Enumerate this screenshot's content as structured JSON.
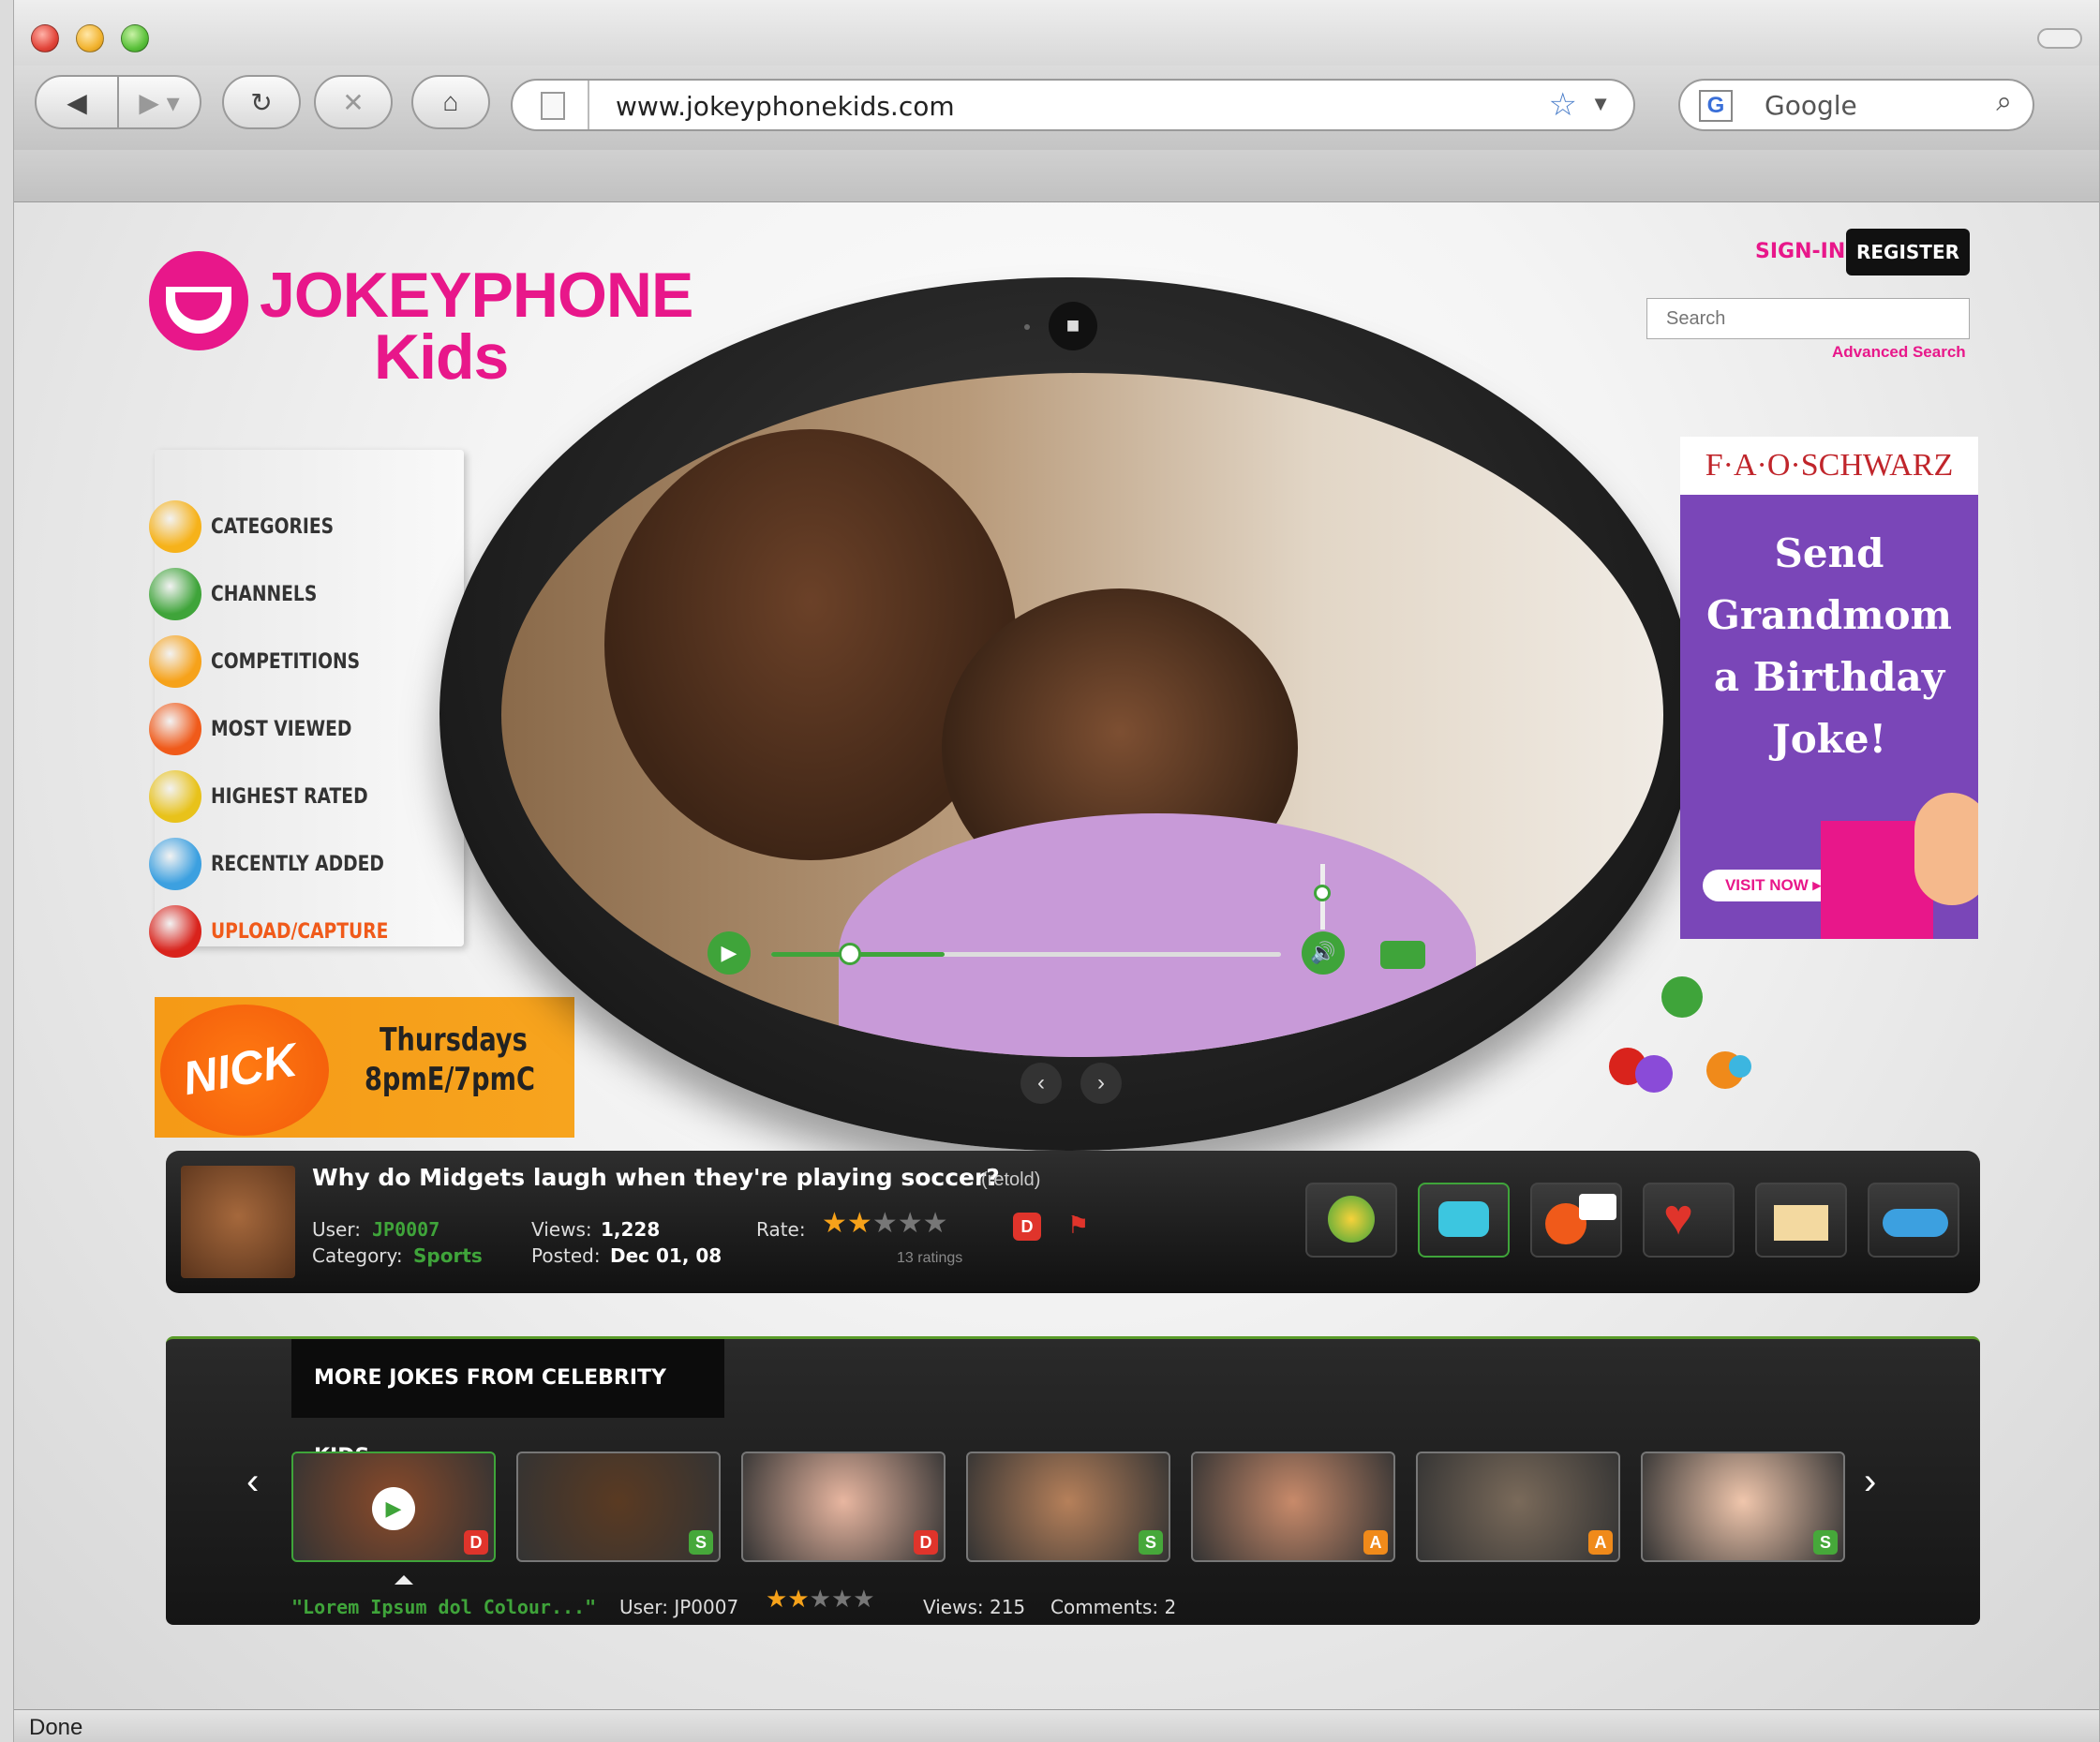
{
  "browser": {
    "url": "www.jokeyphonekids.com",
    "search_placeholder": "Google",
    "status": "Done"
  },
  "header": {
    "logo_line1": "JOKEYPHONE",
    "logo_line2": "Kids",
    "sign_in": "SIGN-IN",
    "register": "REGISTER",
    "search_placeholder": "Search",
    "advanced_search": "Advanced Search"
  },
  "nav": {
    "items": [
      {
        "label": "CATEGORIES",
        "icon": "categories-icon"
      },
      {
        "label": "CHANNELS",
        "icon": "channels-icon"
      },
      {
        "label": "COMPETITIONS",
        "icon": "competitions-icon"
      },
      {
        "label": "MOST VIEWED",
        "icon": "most-viewed-icon"
      },
      {
        "label": "HIGHEST RATED",
        "icon": "highest-rated-icon"
      },
      {
        "label": "RECENTLY ADDED",
        "icon": "recently-added-icon"
      },
      {
        "label": "UPLOAD/CAPTURE",
        "icon": "upload-capture-icon"
      }
    ]
  },
  "nick_ad": {
    "brand": "NICK",
    "line1": "Thursdays",
    "line2": "8pmE/7pmC"
  },
  "fao_ad": {
    "brand": "F·A·O·SCHWARZ",
    "line1": "Send",
    "line2": "Grandmom",
    "line3": "a Birthday",
    "line4": "Joke!",
    "cta": "VISIT NOW ▸"
  },
  "player": {
    "progress": 0.34,
    "volume": 0.7
  },
  "joke": {
    "title": "Why do Midgets laugh when they're playing soccer?",
    "retold": "(retold)",
    "user_label": "User:",
    "user": "JP0007",
    "category_label": "Category:",
    "category": "Sports",
    "views_label": "Views:",
    "views": "1,228",
    "posted_label": "Posted:",
    "posted": "Dec 01, 08",
    "rate_label": "Rate:",
    "rating": 2,
    "rating_max": 5,
    "ratings_count": "13 ratings",
    "rating_badge": "D"
  },
  "more": {
    "title": "MORE JOKES FROM CELEBRITY KIDS",
    "caption_quote": "\"Lorem Ipsum dol Colour...\"",
    "caption_user": "User: JP0007",
    "caption_rating": 2,
    "caption_views": "Views: 215",
    "caption_comments": "Comments: 2",
    "thumbs": [
      {
        "badge": "D",
        "color": "#e0342b"
      },
      {
        "badge": "S",
        "color": "#46a83a"
      },
      {
        "badge": "D",
        "color": "#e0342b"
      },
      {
        "badge": "S",
        "color": "#46a83a"
      },
      {
        "badge": "A",
        "color": "#f08a1a"
      },
      {
        "badge": "A",
        "color": "#f08a1a"
      },
      {
        "badge": "S",
        "color": "#46a83a"
      }
    ]
  }
}
